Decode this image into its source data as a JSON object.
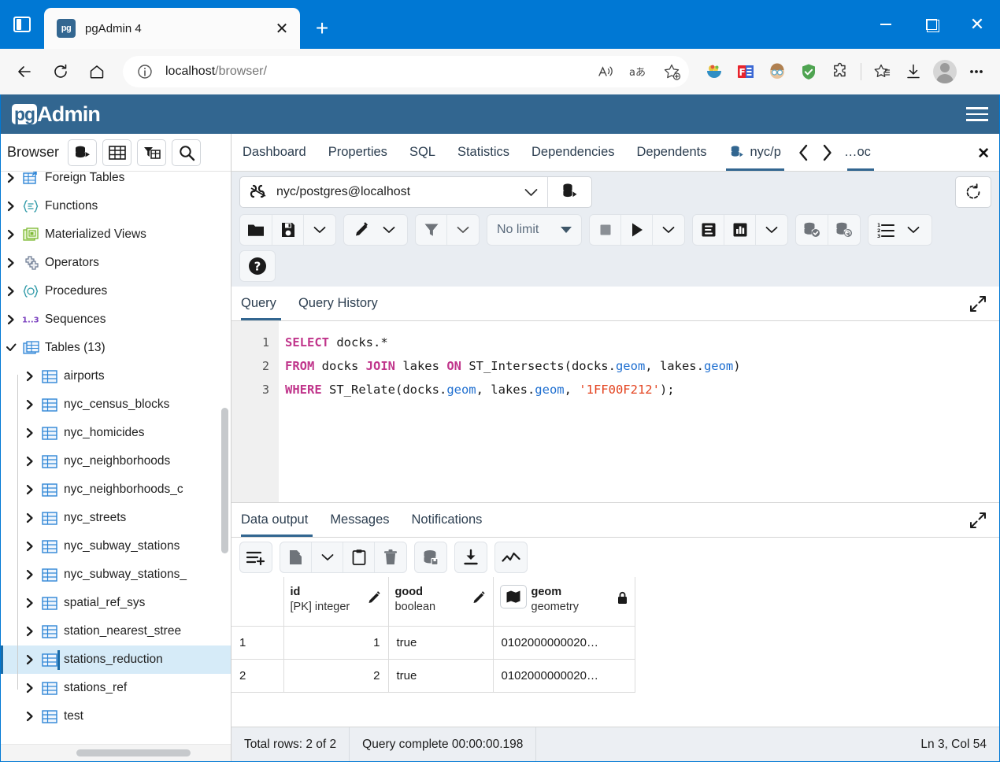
{
  "browser": {
    "tab_title": "pgAdmin 4",
    "favicon_text": "pg",
    "url_prefix": "localhost",
    "url_suffix": "/browser/",
    "new_tab_label": "+",
    "close_tab_label": "✕",
    "window_close_label": "✕",
    "extensions": [
      "fruit-bowl-icon",
      "f-logo-icon",
      "face-avatar-icon",
      "shield-check-icon",
      "puzzle-extension-icon",
      "favorites-star-icon",
      "downloads-icon",
      "profile-avatar-icon",
      "settings-more-icon"
    ]
  },
  "pgadmin": {
    "logo_badge": "pg",
    "logo_text": "Admin",
    "header_color": "#326690"
  },
  "sidebar": {
    "title": "Browser",
    "buttons": [
      "object-explorer-icon",
      "grid-icon",
      "filter-grid-icon",
      "search-icon"
    ],
    "tree": [
      {
        "label": "Foreign Tables",
        "level": 0,
        "icon": "foreign-table-icon",
        "selected": false
      },
      {
        "label": "Functions",
        "level": 0,
        "icon": "function-icon",
        "selected": false
      },
      {
        "label": "Materialized Views",
        "level": 0,
        "icon": "materialized-view-icon",
        "selected": false
      },
      {
        "label": "Operators",
        "level": 0,
        "icon": "operator-icon",
        "selected": false
      },
      {
        "label": "Procedures",
        "level": 0,
        "icon": "procedure-icon",
        "selected": false
      },
      {
        "label": "Sequences",
        "level": 0,
        "icon": "sequence-icon",
        "selected": false
      },
      {
        "label": "Tables (13)",
        "level": 0,
        "icon": "tables-icon",
        "selected": false,
        "expanded": true
      },
      {
        "label": "airports",
        "level": 1,
        "icon": "table-icon",
        "selected": false
      },
      {
        "label": "nyc_census_blocks",
        "level": 1,
        "icon": "table-icon",
        "selected": false
      },
      {
        "label": "nyc_homicides",
        "level": 1,
        "icon": "table-icon",
        "selected": false
      },
      {
        "label": "nyc_neighborhoods",
        "level": 1,
        "icon": "table-icon",
        "selected": false
      },
      {
        "label": "nyc_neighborhoods_c",
        "level": 1,
        "icon": "table-icon",
        "selected": false
      },
      {
        "label": "nyc_streets",
        "level": 1,
        "icon": "table-icon",
        "selected": false
      },
      {
        "label": "nyc_subway_stations",
        "level": 1,
        "icon": "table-icon",
        "selected": false
      },
      {
        "label": "nyc_subway_stations_",
        "level": 1,
        "icon": "table-icon",
        "selected": false
      },
      {
        "label": "spatial_ref_sys",
        "level": 1,
        "icon": "table-icon",
        "selected": false
      },
      {
        "label": "station_nearest_stree",
        "level": 1,
        "icon": "table-icon",
        "selected": false
      },
      {
        "label": "stations_reduction",
        "level": 1,
        "icon": "table-icon",
        "selected": true
      },
      {
        "label": "stations_ref",
        "level": 1,
        "icon": "table-icon",
        "selected": false
      },
      {
        "label": "test",
        "level": 1,
        "icon": "table-icon",
        "selected": false
      }
    ]
  },
  "main_tabs": {
    "items": [
      "Dashboard",
      "Properties",
      "SQL",
      "Statistics",
      "Dependencies",
      "Dependents"
    ],
    "object_tab": "nyc/p",
    "clipped_tab": "…oc",
    "prev_arrow": "‹",
    "next_arrow": "›",
    "close_label": "✕"
  },
  "query_tool": {
    "connection": "nyc/postgres@localhost",
    "row_limit": "No limit",
    "toolbar_groups": [
      {
        "buttons": [
          {
            "icon": "open-file-icon"
          },
          {
            "icon": "save-file-icon"
          },
          {
            "icon": "chevron-down-icon"
          }
        ]
      },
      {
        "buttons": [
          {
            "icon": "edit-pencil-icon"
          },
          {
            "icon": "chevron-down-icon"
          }
        ]
      },
      {
        "buttons": [
          {
            "icon": "filter-icon"
          },
          {
            "icon": "chevron-down-icon"
          }
        ]
      },
      {
        "buttons": [
          {
            "icon": "stop-icon"
          },
          {
            "icon": "play-execute-icon"
          },
          {
            "icon": "chevron-down-icon"
          }
        ]
      },
      {
        "buttons": [
          {
            "icon": "explain-icon"
          },
          {
            "icon": "explain-analyze-icon"
          },
          {
            "icon": "chevron-down-icon"
          }
        ]
      },
      {
        "buttons": [
          {
            "icon": "commit-icon"
          },
          {
            "icon": "rollback-icon"
          }
        ]
      },
      {
        "buttons": [
          {
            "icon": "macros-list-icon"
          },
          {
            "icon": "chevron-down-icon"
          }
        ]
      }
    ],
    "help_icon": "help-question-icon",
    "refresh_icon": "refresh-icon",
    "editor_tabs": [
      "Query",
      "Query History"
    ],
    "active_editor_tab": "Query",
    "sql_lines": [
      {
        "n": "1",
        "tokens": [
          {
            "t": "SELECT",
            "c": "kw"
          },
          {
            "t": " docks.*",
            "c": "pn"
          }
        ]
      },
      {
        "n": "2",
        "tokens": [
          {
            "t": "FROM",
            "c": "kw"
          },
          {
            "t": " docks ",
            "c": "pn"
          },
          {
            "t": "JOIN",
            "c": "kw"
          },
          {
            "t": " lakes ",
            "c": "pn"
          },
          {
            "t": "ON",
            "c": "kw"
          },
          {
            "t": " ST_Intersects(docks.",
            "c": "pn"
          },
          {
            "t": "geom",
            "c": "prop"
          },
          {
            "t": ", lakes.",
            "c": "pn"
          },
          {
            "t": "geom",
            "c": "prop"
          },
          {
            "t": ")",
            "c": "pn"
          }
        ]
      },
      {
        "n": "3",
        "tokens": [
          {
            "t": "WHERE",
            "c": "kw"
          },
          {
            "t": " ST_Relate(docks.",
            "c": "pn"
          },
          {
            "t": "geom",
            "c": "prop"
          },
          {
            "t": ", lakes.",
            "c": "pn"
          },
          {
            "t": "geom",
            "c": "prop"
          },
          {
            "t": ", ",
            "c": "pn"
          },
          {
            "t": "'1FF00F212'",
            "c": "str"
          },
          {
            "t": ");",
            "c": "pn"
          }
        ]
      }
    ]
  },
  "output": {
    "tabs": [
      "Data output",
      "Messages",
      "Notifications"
    ],
    "active_tab": "Data output",
    "toolbar": [
      "add-row-icon",
      "copy-icon",
      "chevron-down-icon",
      "paste-icon",
      "delete-icon",
      "save-data-icon",
      "download-icon",
      "graph-visualiser-icon"
    ],
    "columns": [
      {
        "name": "",
        "type": "",
        "editable": false,
        "rownum": true
      },
      {
        "name": "id",
        "type": "[PK] integer",
        "editable": true,
        "icon": "pencil-icon"
      },
      {
        "name": "good",
        "type": "boolean",
        "editable": true,
        "icon": "pencil-icon"
      },
      {
        "name": "geom",
        "type": "geometry",
        "editable": false,
        "icon": "lock-icon",
        "prefix_icon": "map-icon"
      }
    ],
    "rows": [
      {
        "rownum": "1",
        "id": "1",
        "good": "true",
        "geom": "0102000000020…"
      },
      {
        "rownum": "2",
        "id": "2",
        "good": "true",
        "geom": "0102000000020…"
      }
    ]
  },
  "statusbar": {
    "total_rows": "Total rows: 2 of 2",
    "query_status": "Query complete 00:00:00.198",
    "cursor_position": "Ln 3, Col 54"
  }
}
